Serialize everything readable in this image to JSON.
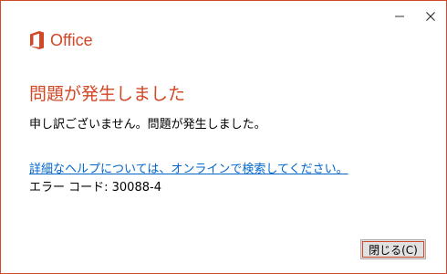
{
  "window": {
    "accent_color": "#d24726",
    "controls": {
      "minimize_icon": "minimize-icon",
      "close_icon": "close-icon"
    }
  },
  "logo": {
    "icon": "office-logo-icon",
    "text": "Office"
  },
  "heading": "問題が発生しました",
  "message": "申し訳ございません。問題が発生しました。",
  "help_link": "詳細なヘルプについては、オンラインで検索してください。",
  "error_code": "エラー コード: 30088-4",
  "buttons": {
    "close_label": "閉じる(C)"
  }
}
